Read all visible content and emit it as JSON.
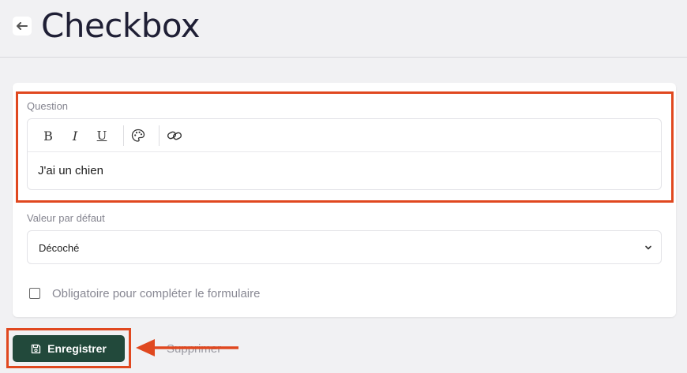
{
  "header": {
    "title": "Checkbox",
    "back_icon": "arrow-left-icon"
  },
  "form": {
    "question_label": "Question",
    "toolbar": {
      "bold": "B",
      "italic": "I",
      "underline": "U",
      "color_icon": "palette-icon",
      "link_icon": "link-icon"
    },
    "question_value": "J'ai un chien",
    "default_label": "Valeur par défaut",
    "default_value": "Décoché",
    "required_label": "Obligatoire pour compléter le formulaire",
    "required_checked": false
  },
  "actions": {
    "save_label": "Enregistrer",
    "save_icon": "floppy-disk-icon",
    "delete_label": "Supprimer"
  },
  "annotations": {
    "highlight_color": "#e0481f"
  },
  "colors": {
    "primary_button": "#22493b",
    "title": "#1f1f35",
    "background": "#f1f1f3"
  }
}
